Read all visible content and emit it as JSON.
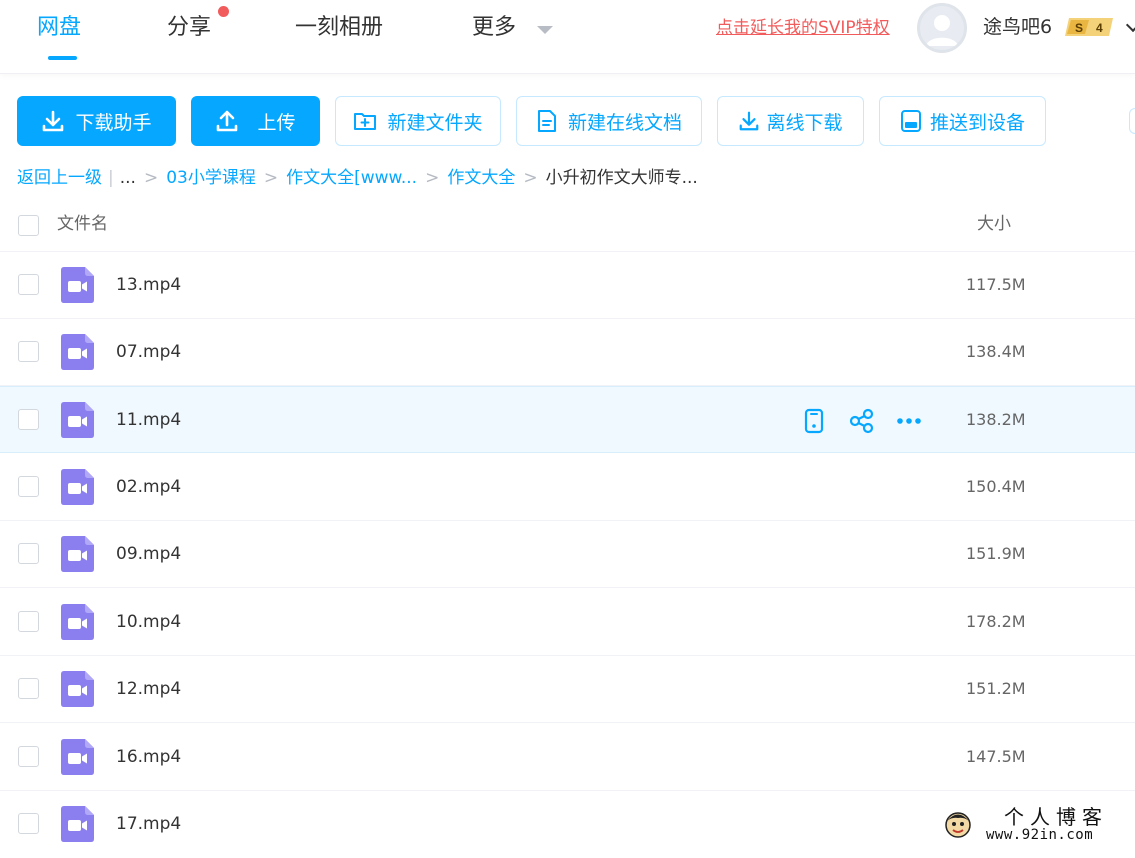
{
  "nav": {
    "tabs": [
      {
        "label": "网盘",
        "active": true
      },
      {
        "label": "分享",
        "badge": "red-dot"
      },
      {
        "label": "一刻相册"
      },
      {
        "label": "更多"
      }
    ],
    "svip_link": "点击延长我的SVIP特权",
    "username": "途鸟吧6",
    "vip_badge": {
      "prefix": "S",
      "level": "4"
    }
  },
  "toolbar": {
    "download_helper": "下载助手",
    "upload": "上传",
    "new_folder": "新建文件夹",
    "new_online_doc": "新建在线文档",
    "offline_download": "离线下载",
    "push_to_device": "推送到设备"
  },
  "breadcrumb": {
    "back": "返回上一级",
    "ellipsis": "...",
    "items": [
      "03小学课程",
      "作文大全[www...",
      "作文大全",
      "小升初作文大师专..."
    ]
  },
  "table": {
    "header_name": "文件名",
    "header_size": "大小",
    "rows": [
      {
        "name": "13.mp4",
        "size": "117.5M"
      },
      {
        "name": "07.mp4",
        "size": "138.4M"
      },
      {
        "name": "11.mp4",
        "size": "138.2M",
        "hovered": true
      },
      {
        "name": "02.mp4",
        "size": "150.4M"
      },
      {
        "name": "09.mp4",
        "size": "151.9M"
      },
      {
        "name": "10.mp4",
        "size": "178.2M"
      },
      {
        "name": "12.mp4",
        "size": "151.2M"
      },
      {
        "name": "16.mp4",
        "size": "147.5M"
      },
      {
        "name": "17.mp4",
        "size": ""
      }
    ]
  },
  "watermark": {
    "title": "个人博客",
    "url": "www.92in.com"
  },
  "colors": {
    "accent": "#06a7ff",
    "svip_red": "#f25b5b",
    "video_icon": "#8b7ff0",
    "hover_row": "#f0f9ff"
  }
}
